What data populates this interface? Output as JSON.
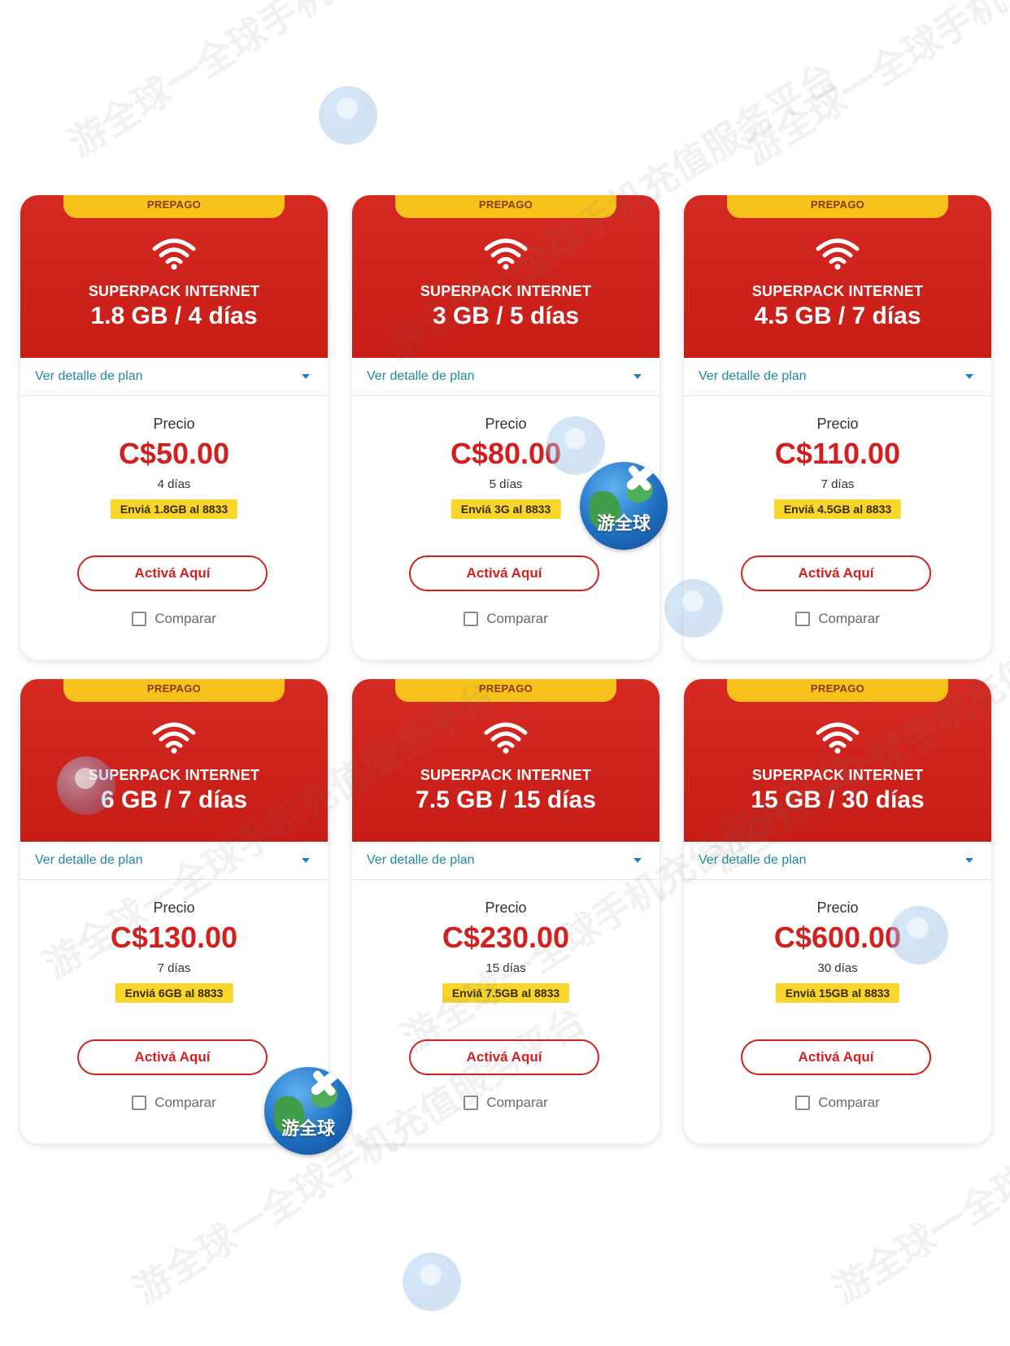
{
  "plans": [
    {
      "tag": "PREPAGO",
      "name": "SUPERPACK INTERNET",
      "size": "1.8 GB / 4 días",
      "detail_link": "Ver detalle de plan",
      "price_label": "Precio",
      "price": "C$50.00",
      "days": "4 días",
      "sms": "Enviá 1.8GB al 8833",
      "cta": "Activá Aquí",
      "compare": "Comparar"
    },
    {
      "tag": "PREPAGO",
      "name": "SUPERPACK INTERNET",
      "size": "3 GB / 5 días",
      "detail_link": "Ver detalle de plan",
      "price_label": "Precio",
      "price": "C$80.00",
      "days": "5 días",
      "sms": "Enviá 3G al 8833",
      "cta": "Activá Aquí",
      "compare": "Comparar"
    },
    {
      "tag": "PREPAGO",
      "name": "SUPERPACK INTERNET",
      "size": "4.5 GB / 7 días",
      "detail_link": "Ver detalle de plan",
      "price_label": "Precio",
      "price": "C$110.00",
      "days": "7 días",
      "sms": "Enviá 4.5GB al 8833",
      "cta": "Activá Aquí",
      "compare": "Comparar"
    },
    {
      "tag": "PREPAGO",
      "name": "SUPERPACK INTERNET",
      "size": "6 GB / 7 días",
      "detail_link": "Ver detalle de plan",
      "price_label": "Precio",
      "price": "C$130.00",
      "days": "7 días",
      "sms": "Enviá 6GB al 8833",
      "cta": "Activá Aquí",
      "compare": "Comparar"
    },
    {
      "tag": "PREPAGO",
      "name": "SUPERPACK INTERNET",
      "size": "7.5 GB / 15 días",
      "detail_link": "Ver detalle de plan",
      "price_label": "Precio",
      "price": "C$230.00",
      "days": "15 días",
      "sms": "Enviá 7.5GB al 8833",
      "cta": "Activá Aquí",
      "compare": "Comparar"
    },
    {
      "tag": "PREPAGO",
      "name": "SUPERPACK INTERNET",
      "size": "15 GB / 30 días",
      "detail_link": "Ver detalle de plan",
      "price_label": "Precio",
      "price": "C$600.00",
      "days": "30 días",
      "sms": "Enviá 15GB al 8833",
      "cta": "Activá Aquí",
      "compare": "Comparar"
    }
  ],
  "watermark": {
    "text": "游全球一全球手机充值服务平台",
    "badge_text": "游全球"
  },
  "colors": {
    "header_red": "#c81d17",
    "tag_yellow": "#f7c21b",
    "sms_yellow": "#f8d52a",
    "price_red": "#d41f1f",
    "link_teal": "#1d8a9c"
  },
  "icons": {
    "plan_icon": "wifi-icon",
    "detail_toggle": "chevron-down-icon",
    "compare_box": "checkbox-icon"
  }
}
